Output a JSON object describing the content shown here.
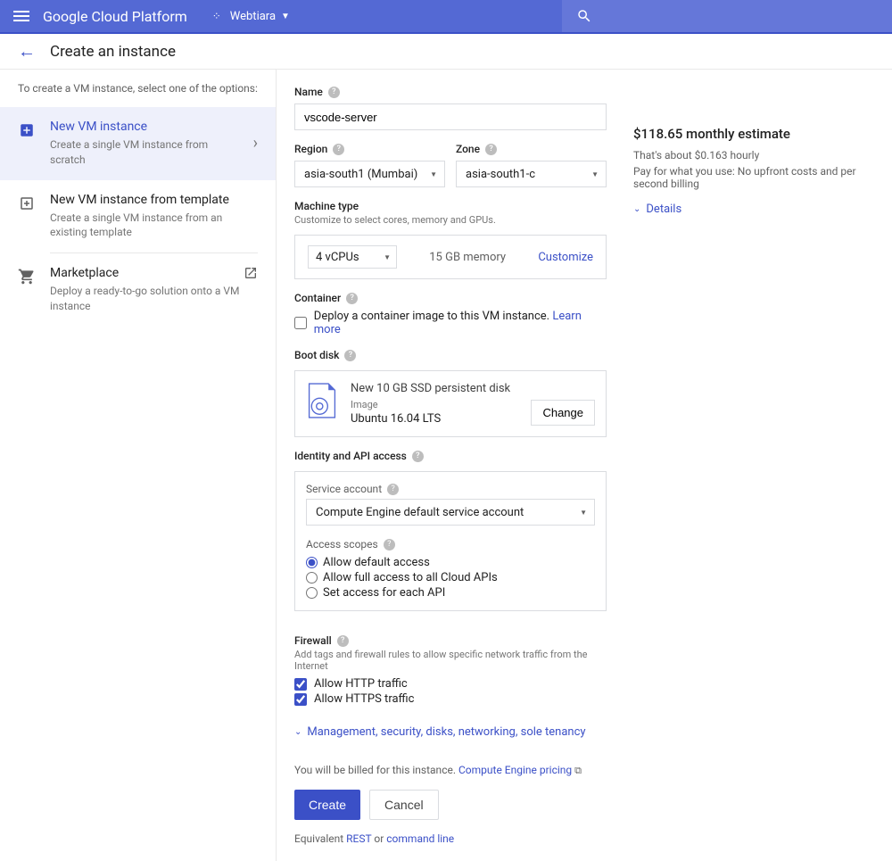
{
  "topbar": {
    "brand": "Google Cloud Platform",
    "project": "Webtiara"
  },
  "page": {
    "title": "Create an instance"
  },
  "sidebar": {
    "hint": "To create a VM instance, select one of the options:",
    "items": [
      {
        "title": "New VM instance",
        "subtitle": "Create a single VM instance from scratch"
      },
      {
        "title": "New VM instance from template",
        "subtitle": "Create a single VM instance from an existing template"
      },
      {
        "title": "Marketplace",
        "subtitle": "Deploy a ready-to-go solution onto a VM instance"
      }
    ]
  },
  "form": {
    "name_label": "Name",
    "name_value": "vscode-server",
    "region_label": "Region",
    "region_value": "asia-south1 (Mumbai)",
    "zone_label": "Zone",
    "zone_value": "asia-south1-c",
    "machine_type_label": "Machine type",
    "machine_type_helper": "Customize to select cores, memory and GPUs.",
    "machine_vcpus": "4 vCPUs",
    "machine_memory": "15 GB memory",
    "customize": "Customize",
    "container_label": "Container",
    "container_checkbox": "Deploy a container image to this VM instance.",
    "learn_more": "Learn more",
    "bootdisk_label": "Boot disk",
    "bootdisk_line1": "New 10 GB SSD persistent disk",
    "bootdisk_line2": "Image",
    "bootdisk_line3": "Ubuntu 16.04 LTS",
    "change": "Change",
    "identity_label": "Identity and API access",
    "service_account_label": "Service account",
    "service_account_value": "Compute Engine default service account",
    "access_scopes_label": "Access scopes",
    "scope_default": "Allow default access",
    "scope_full": "Allow full access to all Cloud APIs",
    "scope_each": "Set access for each API",
    "firewall_label": "Firewall",
    "firewall_helper": "Add tags and firewall rules to allow specific network traffic from the Internet",
    "firewall_http": "Allow HTTP traffic",
    "firewall_https": "Allow HTTPS traffic",
    "expand_label": "Management, security, disks, networking, sole tenancy",
    "billing_note_prefix": "You will be billed for this instance. ",
    "billing_link": "Compute Engine pricing",
    "create": "Create",
    "cancel": "Cancel",
    "equivalent_prefix": "Equivalent ",
    "equivalent_rest": "REST",
    "equivalent_or": " or ",
    "equivalent_cli": "command line"
  },
  "estimate": {
    "title": "$118.65 monthly estimate",
    "hourly": "That's about $0.163 hourly",
    "billing": "Pay for what you use: No upfront costs and per second billing",
    "details": "Details"
  }
}
